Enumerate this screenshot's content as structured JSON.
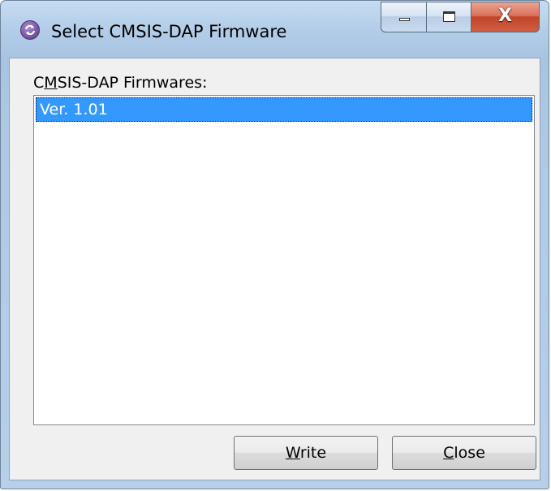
{
  "window": {
    "title": "Select CMSIS-DAP Firmware",
    "icon": "app-refresh-icon",
    "caption_buttons": [
      "minimize",
      "maximize",
      "close"
    ],
    "close_glyph": "X"
  },
  "firmware_list": {
    "label_prefix": "C",
    "label_mnemonic": "M",
    "label_rest": "SIS-DAP Firmwares:",
    "items": [
      {
        "label": "Ver. 1.01",
        "selected": true
      }
    ]
  },
  "buttons": {
    "write": {
      "mnemonic": "W",
      "rest": "rite"
    },
    "close": {
      "mnemonic": "C",
      "rest": "lose"
    }
  },
  "colors": {
    "selection": "#3399ff",
    "close_button": "#c2442a",
    "frame": "#b3cde8"
  }
}
